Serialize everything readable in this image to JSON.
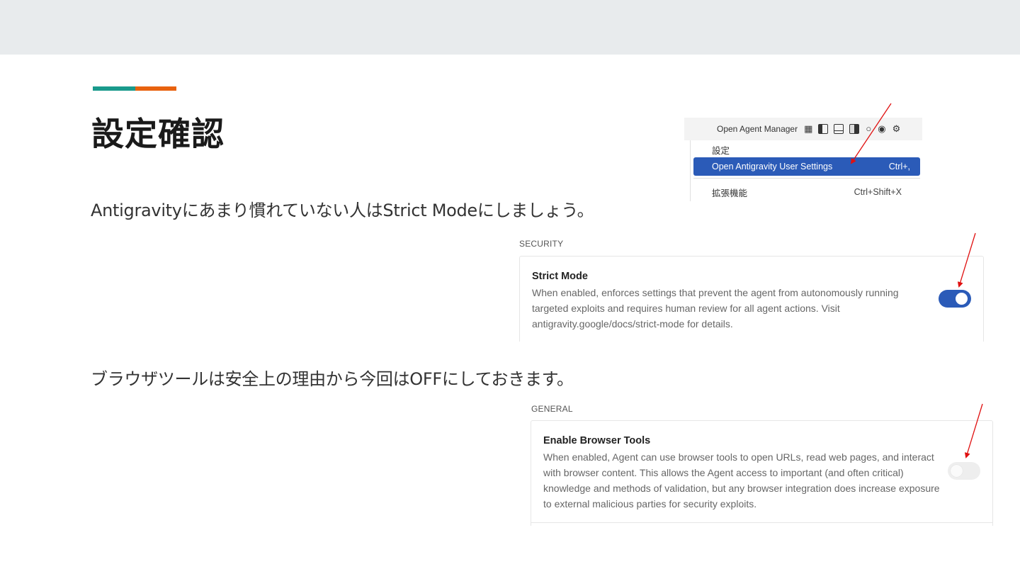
{
  "slide": {
    "title": "設定確認",
    "line1": "Antigravityにあまり慣れていない人はStrict Modeにしましょう。",
    "line2": "ブラウザツールは安全上の理由から今回はOFFにしておきます。",
    "accent_colors": [
      "#1a9a8c",
      "#e8620f"
    ]
  },
  "menu": {
    "toolbar_label": "Open Agent Manager",
    "toolbar_icons": [
      "layout-grid-icon",
      "panel-left-icon",
      "panel-bottom-icon",
      "panel-right-icon",
      "search-icon",
      "chrome-icon",
      "gear-icon"
    ],
    "header": "設定",
    "selected_label": "Open Antigravity User Settings",
    "selected_shortcut": "Ctrl+,",
    "ext_label": "拡張機能",
    "ext_shortcut": "Ctrl+Shift+X",
    "highlight_color": "#2b5bb8"
  },
  "security": {
    "section": "SECURITY",
    "title": "Strict Mode",
    "description": "When enabled, enforces settings that prevent the agent from autonomously running targeted exploits and requires human review for all agent actions. Visit antigravity.google/docs/strict-mode for details.",
    "enabled": true
  },
  "general": {
    "section": "GENERAL",
    "title": "Enable Browser Tools",
    "description": "When enabled, Agent can use browser tools to open URLs, read web pages, and interact with browser content. This allows the Agent access to important (and often critical) knowledge and methods of validation, but any browser integration does increase exposure to external malicious parties for security exploits.",
    "enabled": false
  },
  "arrow_color": "#e01010"
}
